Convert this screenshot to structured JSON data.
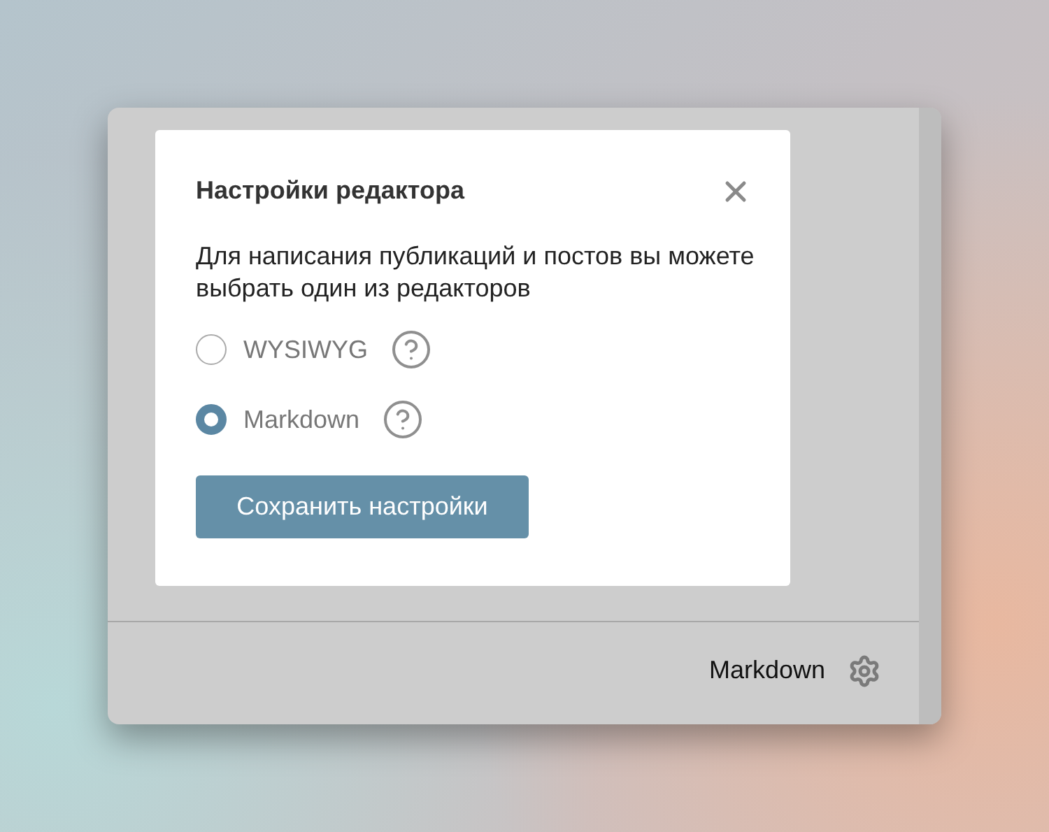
{
  "dialog": {
    "title": "Настройки редактора",
    "description": "Для написания публикаций и постов вы можете выбрать один из редакторов",
    "options": [
      {
        "label": "WYSIWYG",
        "selected": false
      },
      {
        "label": "Markdown",
        "selected": true
      }
    ],
    "save_button": "Сохранить настройки"
  },
  "status_bar": {
    "editor_label": "Markdown"
  }
}
